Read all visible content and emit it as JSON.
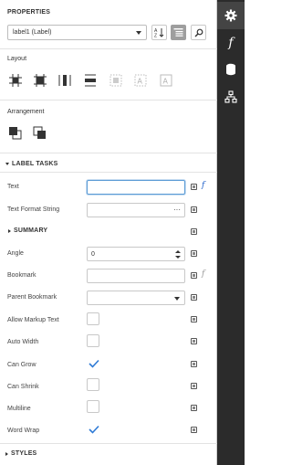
{
  "panel": {
    "title": "PROPERTIES",
    "selected_control": "label1 (Label)"
  },
  "sections": {
    "layout": "Layout",
    "arrangement": "Arrangement"
  },
  "groups": {
    "label_tasks": "LABEL TASKS",
    "summary": "SUMMARY",
    "styles": "STYLES"
  },
  "properties": {
    "text": {
      "label": "Text",
      "value": ""
    },
    "text_format_string": {
      "label": "Text Format String",
      "value": "",
      "button": "···"
    },
    "angle": {
      "label": "Angle",
      "value": "0"
    },
    "bookmark": {
      "label": "Bookmark",
      "value": ""
    },
    "parent_bookmark": {
      "label": "Parent Bookmark",
      "value": ""
    },
    "allow_markup_text": {
      "label": "Allow Markup Text",
      "checked": false
    },
    "auto_width": {
      "label": "Auto Width",
      "checked": false
    },
    "can_grow": {
      "label": "Can Grow",
      "checked": true
    },
    "can_shrink": {
      "label": "Can Shrink",
      "checked": false
    },
    "multiline": {
      "label": "Multiline",
      "checked": false
    },
    "word_wrap": {
      "label": "Word Wrap",
      "checked": true
    }
  },
  "icons": {
    "fx": "f"
  },
  "colors": {
    "rail_bg": "#2b2b2b",
    "accent": "#2f7bd6",
    "expression_active": "#1e5fc9"
  }
}
